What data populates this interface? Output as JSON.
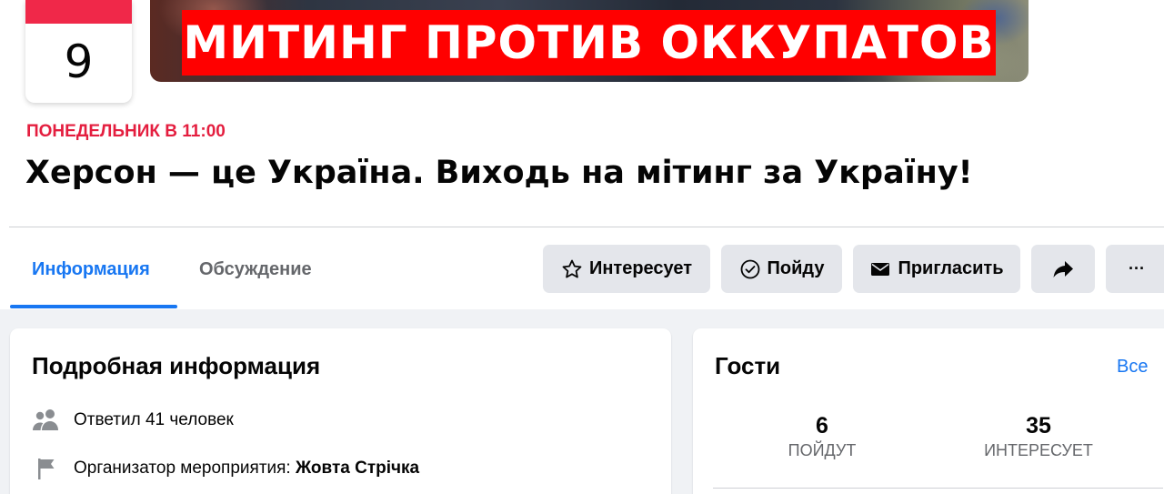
{
  "cover": {
    "day": "9",
    "banner_text": "МИТИНГ ПРОТИВ ОККУПАТОВ",
    "accent": "#f02849",
    "banner_color": "#ff0000"
  },
  "event": {
    "when": "ПОНЕДЕЛЬНИК В 11:00",
    "title": "Херсон — це Україна. Виходь на мітинг за Україну!"
  },
  "tabs": [
    {
      "label": "Информация",
      "active": true
    },
    {
      "label": "Обсуждение",
      "active": false
    }
  ],
  "actions": {
    "interested": {
      "label": "Интересует",
      "icon": "star-icon"
    },
    "going": {
      "label": "Пойду",
      "icon": "check-circle-icon"
    },
    "invite": {
      "label": "Пригласить",
      "icon": "envelope-icon"
    },
    "share": {
      "icon": "share-arrow-icon"
    },
    "more": {
      "label": "···",
      "icon": "more-icon"
    }
  },
  "details": {
    "heading": "Подробная информация",
    "responded": "Ответил 41 человек",
    "organizer_prefix": "Организатор мероприятия:",
    "organizer_name": "Жовта Стрічка"
  },
  "guests": {
    "heading": "Гости",
    "see_all": "Все",
    "going_count": "6",
    "going_label": "ПОЙДУТ",
    "interested_count": "35",
    "interested_label": "ИНТЕРЕСУЕТ"
  },
  "colors": {
    "link": "#1877f2",
    "button_bg": "#e4e6eb",
    "page_bg": "#f0f2f5"
  }
}
